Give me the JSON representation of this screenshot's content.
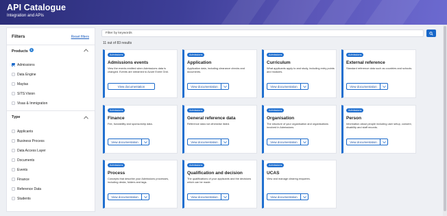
{
  "header": {
    "title": "API Catalogue",
    "subtitle": "Integration and APIs"
  },
  "filters": {
    "title": "Filters",
    "reset_label": "Reset filters",
    "products": {
      "title": "Products",
      "badge": "1",
      "items": [
        {
          "label": "Admissions",
          "checked": true
        },
        {
          "label": "Data Engine",
          "checked": false
        },
        {
          "label": "Maytas",
          "checked": false
        },
        {
          "label": "SITS:Vision",
          "checked": false
        },
        {
          "label": "Visas & Immigration",
          "checked": false
        }
      ]
    },
    "type": {
      "title": "Type",
      "items": [
        {
          "label": "Applicants"
        },
        {
          "label": "Business Process"
        },
        {
          "label": "Data Access Layer"
        },
        {
          "label": "Documents"
        },
        {
          "label": "Events"
        },
        {
          "label": "Finance"
        },
        {
          "label": "Reference Data"
        },
        {
          "label": "Students"
        }
      ]
    }
  },
  "search": {
    "placeholder": "Filter by keywords",
    "button_icon": "search-icon"
  },
  "results_count": "11 out of 83 results",
  "cards": [
    {
      "tag": "Admissions",
      "title": "Admissions events",
      "desc": "View the events emitted when Admissions data is changed. Events are streamed to Azure Event Grid.",
      "button": "View documentation",
      "has_dropdown": false
    },
    {
      "tag": "Admissions",
      "title": "Application",
      "desc": "Application data, including clearance checks and documents.",
      "button": "View documentation",
      "has_dropdown": true
    },
    {
      "tag": "Admissions",
      "title": "Curriculum",
      "desc": "What applicants apply to and study, including entry points and modules.",
      "button": "View documentation",
      "has_dropdown": true
    },
    {
      "tag": "Admissions",
      "title": "External reference",
      "desc": "Standard reference data such as countries and schools.",
      "button": "View documentation",
      "has_dropdown": true
    },
    {
      "tag": "Admissions",
      "title": "Finance",
      "desc": "Fee, fundability and sponsorship data.",
      "button": "View documentation",
      "has_dropdown": true
    },
    {
      "tag": "Admissions",
      "title": "General reference data",
      "desc": "Reference data not otherwise listed.",
      "button": "View documentation",
      "has_dropdown": true
    },
    {
      "tag": "Admissions",
      "title": "Organisation",
      "desc": "The structure of your organisation and organisations involved in Admissions.",
      "button": "View documentation",
      "has_dropdown": true
    },
    {
      "tag": "Admissions",
      "title": "Person",
      "desc": "Information about people including user setup, consent, disability and staff records.",
      "button": "View documentation",
      "has_dropdown": true
    },
    {
      "tag": "Admissions",
      "title": "Process",
      "desc": "Concepts that describe your Admissions processes, including desks, folders and tags.",
      "button": "View documentation",
      "has_dropdown": true
    },
    {
      "tag": "Admissions",
      "title": "Qualification and decision",
      "desc": "The qualifications of your applicants and the decisions which can be made.",
      "button": "View documentation",
      "has_dropdown": true
    },
    {
      "tag": "Admissions",
      "title": "UCAS",
      "desc": "View and manage clearing enquiries.",
      "button": "View documentation",
      "has_dropdown": true
    }
  ],
  "colors": {
    "accent": "#1767c9",
    "header_start": "#2b2d78",
    "header_end": "#6c6ad0"
  }
}
